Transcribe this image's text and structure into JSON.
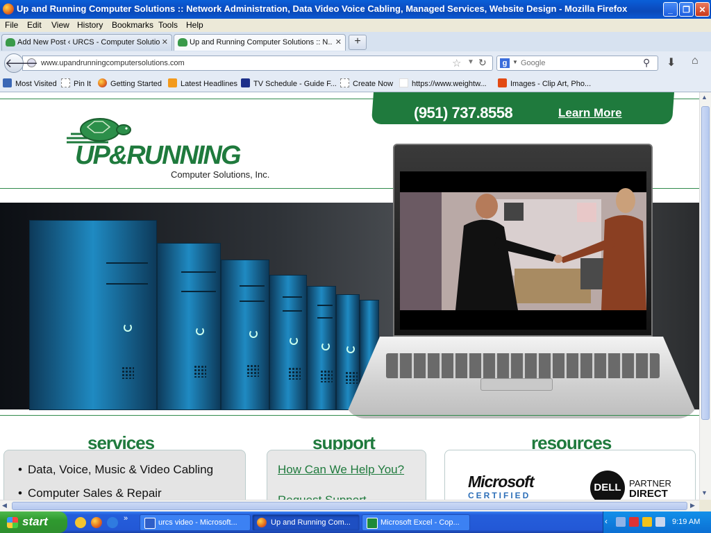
{
  "window": {
    "title": "Up and Running Computer Solutions :: Network Administration, Data Video Voice Cabling, Managed Services, Website Design - Mozilla Firefox"
  },
  "menu": [
    "File",
    "Edit",
    "View",
    "History",
    "Bookmarks",
    "Tools",
    "Help"
  ],
  "tabs": [
    {
      "label": "Add New Post ‹ URCS - Computer Solutio...",
      "active": false
    },
    {
      "label": "Up and Running Computer Solutions :: N...",
      "active": true
    }
  ],
  "nav": {
    "url": "www.upandrunningcomputersolutions.com",
    "search_placeholder": "Google"
  },
  "bookmarks": [
    {
      "label": "Most Visited",
      "icon": "most-visited-icon"
    },
    {
      "label": "Pin It",
      "icon": "page-icon"
    },
    {
      "label": "Getting Started",
      "icon": "firefox-icon"
    },
    {
      "label": "Latest Headlines",
      "icon": "rss-icon"
    },
    {
      "label": "TV Schedule - Guide F...",
      "icon": "tv-guide-icon"
    },
    {
      "label": "Create Now",
      "icon": "page-icon"
    },
    {
      "label": "https://www.weightw...",
      "icon": "page-icon"
    },
    {
      "label": "Images - Clip Art, Pho...",
      "icon": "office-icon"
    }
  ],
  "site": {
    "phone": "(951) 737.8558",
    "learn_more": "Learn More",
    "logo_text": "UP&RUNNING",
    "logo_sub": "Computer Solutions, Inc.",
    "columns": {
      "services": {
        "title": "services",
        "items": [
          "Data, Voice, Music & Video Cabling",
          "Computer Sales & Repair"
        ]
      },
      "support": {
        "title": "support",
        "links": [
          "How Can We Help You?",
          "Request Support"
        ]
      },
      "resources": {
        "title": "resources",
        "ms_logo": "Microsoft",
        "ms_cert": "CERTIFIED",
        "dell": "DELL",
        "dell_partner": "PARTNER",
        "dell_direct": "DIRECT"
      }
    }
  },
  "taskbar": {
    "start": "start",
    "tasks": [
      {
        "label": "urcs video - Microsoft...",
        "icon": "word-icon",
        "active": false
      },
      {
        "label": "Up and Running Com...",
        "icon": "firefox-icon",
        "active": true
      },
      {
        "label": "Microsoft Excel - Cop...",
        "icon": "excel-icon",
        "active": false
      }
    ],
    "clock": "9:19 AM"
  },
  "colors": {
    "brand_green": "#1f7a3d",
    "xp_blue": "#245edb",
    "start_green": "#2f9a2f"
  }
}
